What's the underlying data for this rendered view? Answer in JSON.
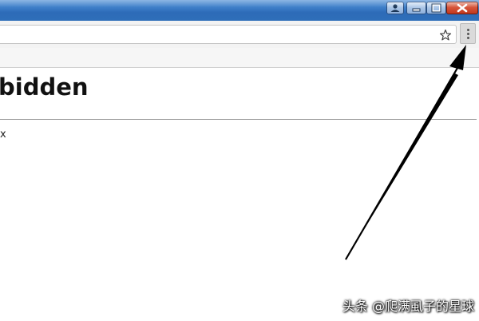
{
  "page": {
    "heading": "bidden",
    "meta": "x"
  },
  "window": {
    "buttons": [
      "user",
      "minimize",
      "maximize",
      "close"
    ]
  },
  "icons": {
    "star": "star-icon",
    "menu": "three-dot-menu-icon"
  },
  "colors": {
    "titlebar": "#3f7fc9",
    "close": "#c2381d",
    "arrow": "#000000"
  },
  "watermark": {
    "text": "头条 @爬满虱子的星球"
  }
}
